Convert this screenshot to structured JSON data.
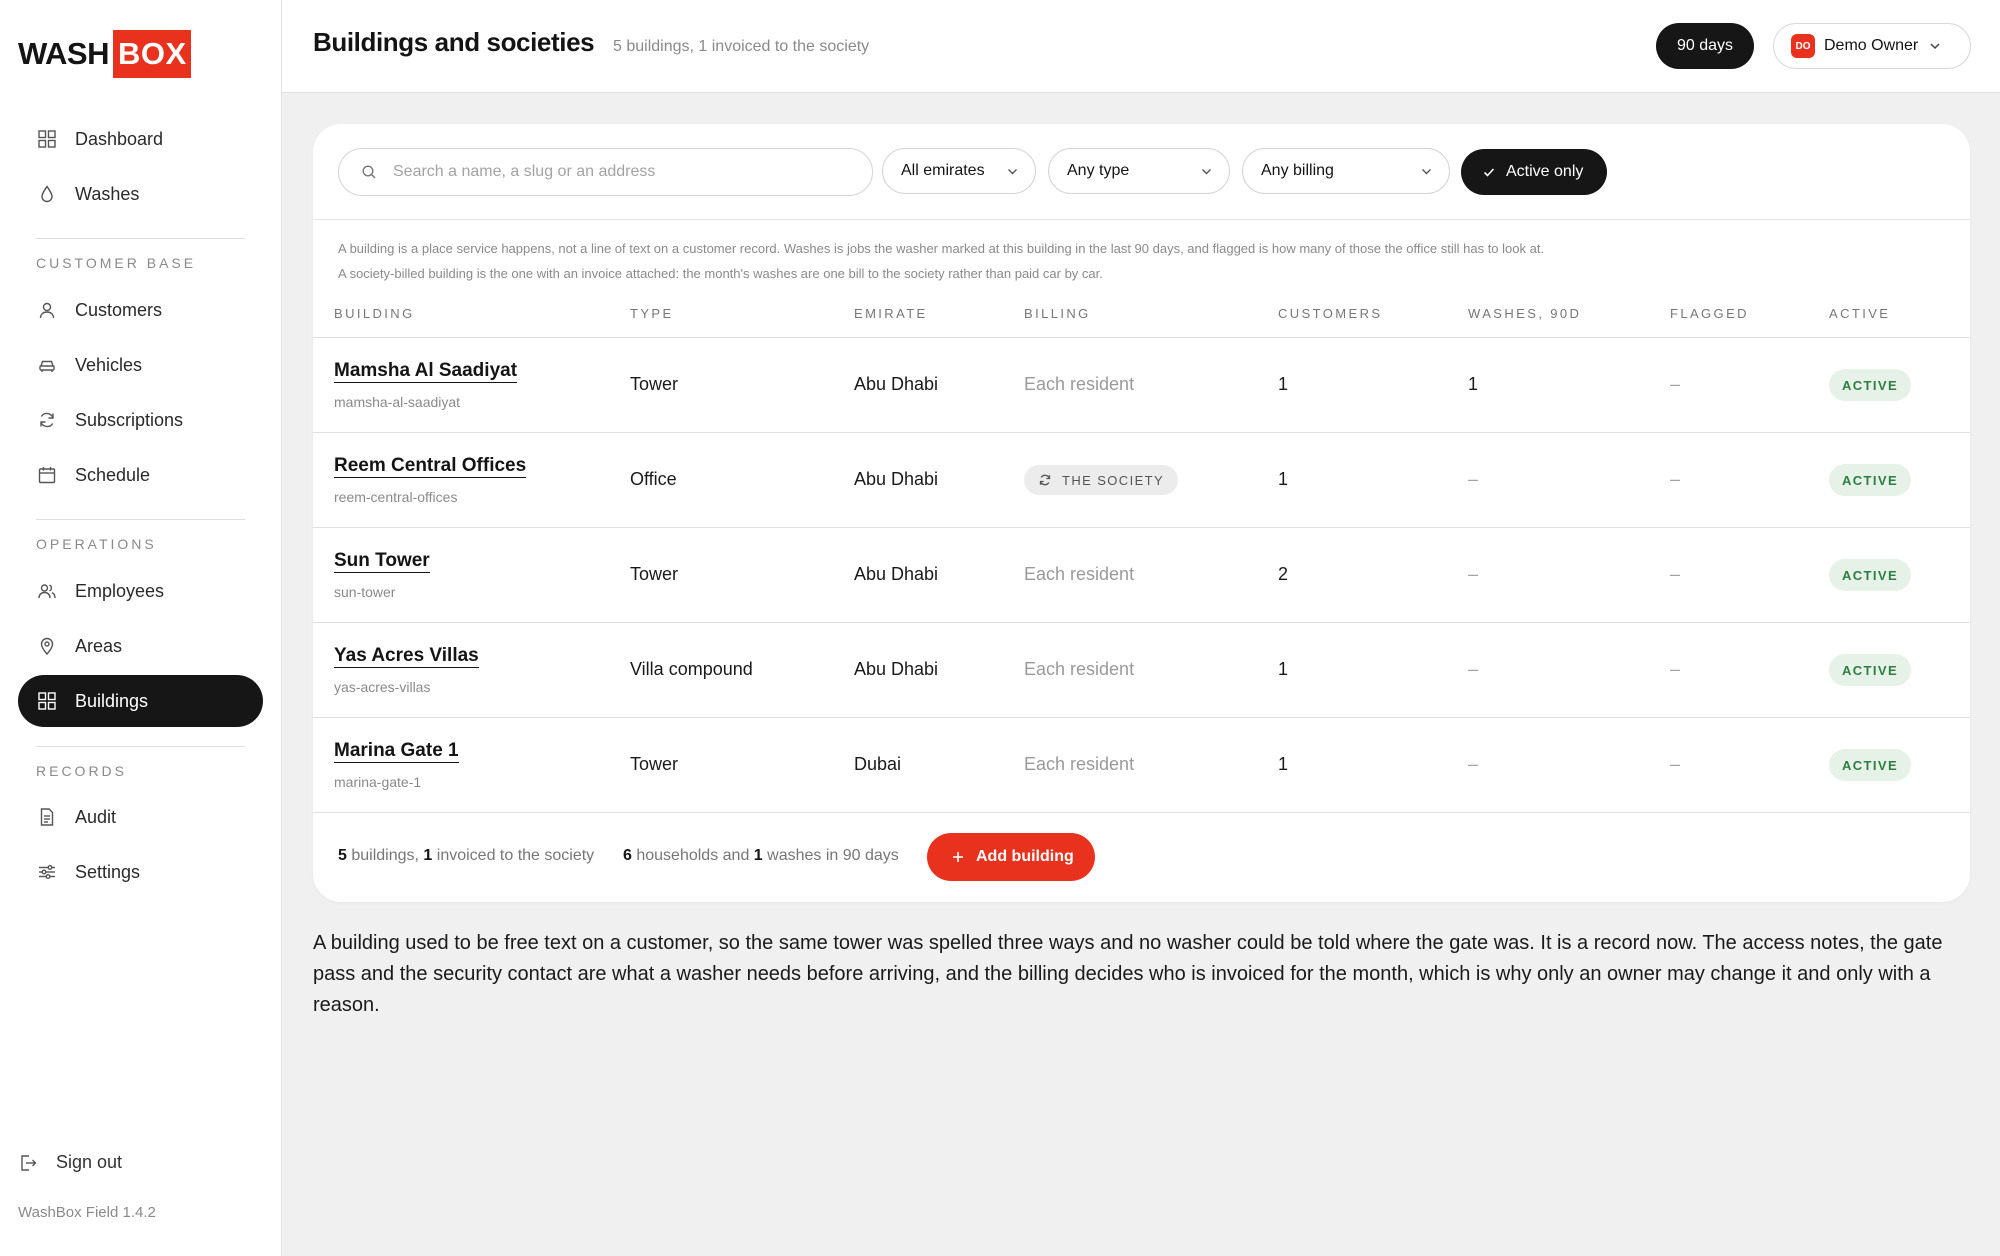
{
  "brand": {
    "wash": "WASH",
    "box": "BOX",
    "accent": "#e8321e"
  },
  "sidebar": {
    "items_top": [
      {
        "label": "Dashboard",
        "icon": "grid-icon"
      },
      {
        "label": "Washes",
        "icon": "drop-icon"
      }
    ],
    "section_customer": "CUSTOMER BASE",
    "items_customer": [
      {
        "label": "Customers",
        "icon": "user-icon"
      },
      {
        "label": "Vehicles",
        "icon": "car-icon"
      },
      {
        "label": "Subscriptions",
        "icon": "refresh-icon"
      },
      {
        "label": "Schedule",
        "icon": "calendar-icon"
      }
    ],
    "section_operations": "OPERATIONS",
    "items_operations": [
      {
        "label": "Employees",
        "icon": "users-icon"
      },
      {
        "label": "Areas",
        "icon": "pin-icon"
      },
      {
        "label": "Buildings",
        "icon": "grid-icon",
        "active": true
      }
    ],
    "section_records": "RECORDS",
    "items_records": [
      {
        "label": "Audit",
        "icon": "document-icon"
      },
      {
        "label": "Settings",
        "icon": "sliders-icon"
      }
    ],
    "signout": "Sign out",
    "version": "WashBox Field 1.4.2"
  },
  "header": {
    "title": "Buildings and societies",
    "subtitle": "5 buildings, 1 invoiced to the society",
    "days": "90 days",
    "owner_initials": "DO",
    "owner_name": "Demo Owner"
  },
  "filters": {
    "search_placeholder": "Search a name, a slug or an address",
    "emirates": "All emirates",
    "type": "Any type",
    "billing": "Any billing",
    "active_only": "Active only"
  },
  "notes": [
    "A building is a place service happens, not a line of text on a customer record. Washes is jobs the washer marked at this building in the last 90 days, and flagged is how many of those the office still has to look at.",
    "A society-billed building is the one with an invoice attached: the month's washes are one bill to the society rather than paid car by car."
  ],
  "table": {
    "headers": [
      "BUILDING",
      "TYPE",
      "EMIRATE",
      "BILLING",
      "CUSTOMERS",
      "WASHES, 90D",
      "FLAGGED",
      "ACTIVE"
    ],
    "rows": [
      {
        "name": "Mamsha Al Saadiyat",
        "slug": "mamsha-al-saadiyat",
        "type": "Tower",
        "emirate": "Abu Dhabi",
        "billing": "Each resident",
        "billing_kind": "resident",
        "customers": "1",
        "washes": "1",
        "flagged": "–",
        "active": "ACTIVE"
      },
      {
        "name": "Reem Central Offices",
        "slug": "reem-central-offices",
        "type": "Office",
        "emirate": "Abu Dhabi",
        "billing": "THE SOCIETY",
        "billing_kind": "society",
        "customers": "1",
        "washes": "–",
        "flagged": "–",
        "active": "ACTIVE"
      },
      {
        "name": "Sun Tower",
        "slug": "sun-tower",
        "type": "Tower",
        "emirate": "Abu Dhabi",
        "billing": "Each resident",
        "billing_kind": "resident",
        "customers": "2",
        "washes": "–",
        "flagged": "–",
        "active": "ACTIVE"
      },
      {
        "name": "Yas Acres Villas",
        "slug": "yas-acres-villas",
        "type": "Villa compound",
        "emirate": "Abu Dhabi",
        "billing": "Each resident",
        "billing_kind": "resident",
        "customers": "1",
        "washes": "–",
        "flagged": "–",
        "active": "ACTIVE"
      },
      {
        "name": "Marina Gate 1",
        "slug": "marina-gate-1",
        "type": "Tower",
        "emirate": "Dubai",
        "billing": "Each resident",
        "billing_kind": "resident",
        "customers": "1",
        "washes": "–",
        "flagged": "–",
        "active": "ACTIVE"
      }
    ]
  },
  "footer": {
    "buildings_count": "5",
    "buildings_mid": " buildings, ",
    "invoiced_count": "1",
    "invoiced_tail": " invoiced to the society",
    "households_count": "6",
    "households_mid": " households and ",
    "washes_count": "1",
    "washes_tail": " washes in 90 days",
    "add_button": "Add building"
  },
  "paragraph": "A building used to be free text on a customer, so the same tower was spelled three ways and no washer could be told where the gate was. It is a record now. The access notes, the gate pass and the security contact are what a washer needs before arriving, and the billing decides who is invoiced for the month, which is why only an owner may change it and only with a reason."
}
